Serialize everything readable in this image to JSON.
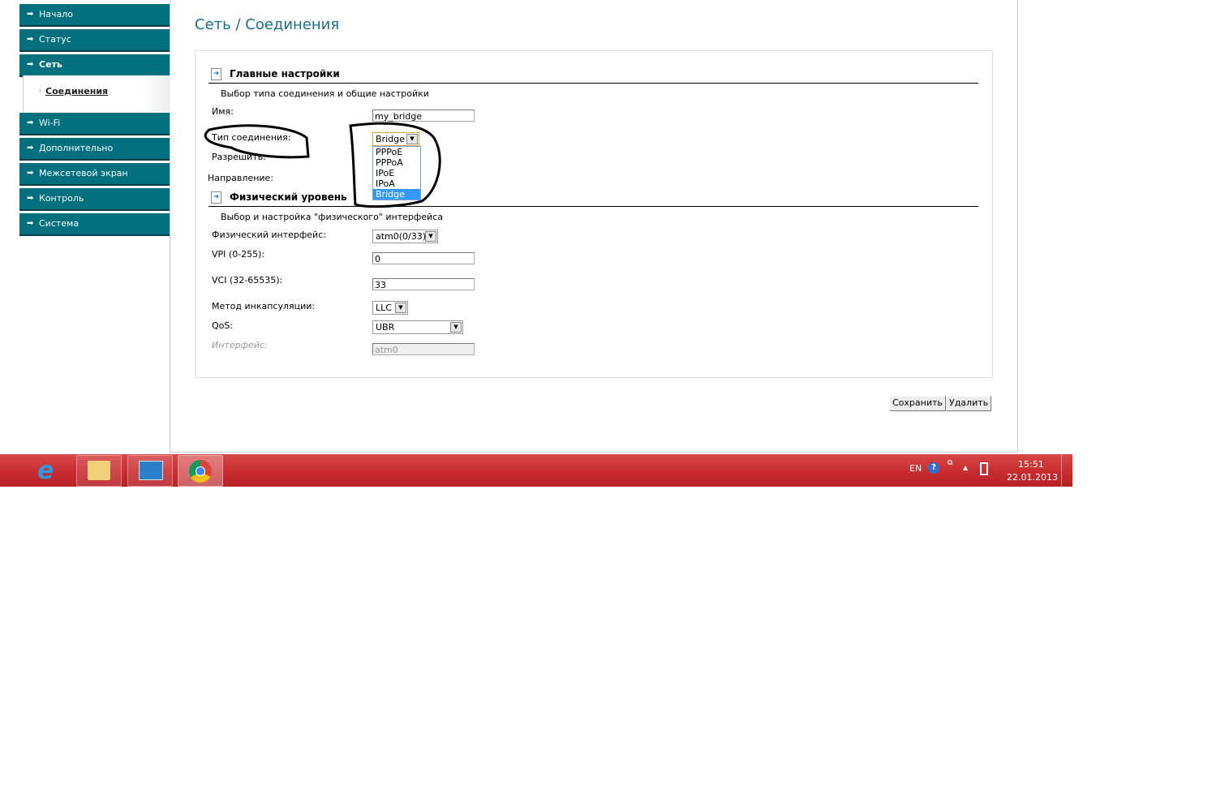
{
  "sidebar": {
    "items": [
      {
        "label": "Начало"
      },
      {
        "label": "Статус"
      },
      {
        "label": "Сеть"
      },
      {
        "label": "Wi-Fi"
      },
      {
        "label": "Дополнительно"
      },
      {
        "label": "Межсетевой экран"
      },
      {
        "label": "Контроль"
      },
      {
        "label": "Система"
      }
    ],
    "sub_item": "Соединения"
  },
  "page_title": "Сеть / Соединения",
  "main_section": {
    "title": "Главные настройки",
    "desc": "Выбор типа соединения и общие настройки",
    "name_label": "Имя:",
    "name_value": "my_bridge",
    "type_label": "Тип соединения:",
    "type_value": "Bridge",
    "type_options": [
      "PPPoE",
      "PPPoA",
      "IPoE",
      "IPoA",
      "Bridge"
    ],
    "allow_label": "Разрешить:",
    "direction_label": "Направление:"
  },
  "phys_section": {
    "title": "Физический уровень",
    "desc": "Выбор и настройка \"физического\" интерфейса",
    "iface_label": "Физический интерфейс:",
    "iface_value": "atm0(0/33)",
    "vpi_label": "VPI (0-255):",
    "vpi_value": "0",
    "vci_label": "VCI (32-65535):",
    "vci_value": "33",
    "encap_label": "Метод инкапсуляции:",
    "encap_value": "LLC",
    "qos_label": "QoS:",
    "qos_value": "UBR",
    "interface_label": "Интерфейс:",
    "interface_value": "atm0"
  },
  "buttons": {
    "save": "Сохранить",
    "delete": "Удалить"
  },
  "taskbar": {
    "lang": "EN",
    "time": "15:51",
    "date": "22.01.2013"
  },
  "colors": {
    "nav": "#00707f",
    "title": "#1a6e8c",
    "taskbar": "#c52a2e",
    "highlight": "#3399ff"
  }
}
